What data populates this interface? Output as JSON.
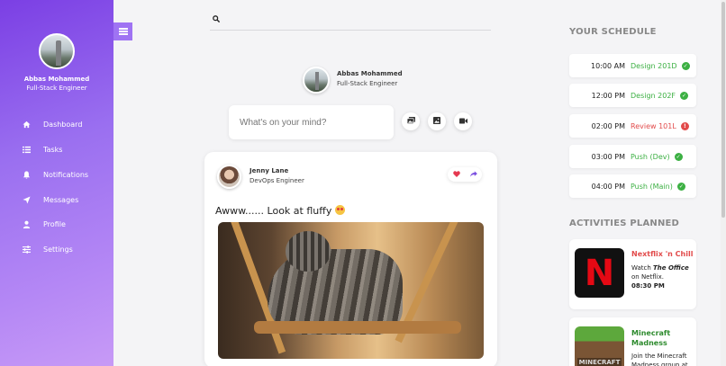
{
  "user": {
    "name": "Abbas Mohammed",
    "role": "Full-Stack Engineer"
  },
  "sidebar": {
    "items": [
      {
        "label": "Dashboard",
        "icon": "home-icon"
      },
      {
        "label": "Tasks",
        "icon": "list-icon"
      },
      {
        "label": "Notifications",
        "icon": "bell-icon"
      },
      {
        "label": "Messages",
        "icon": "send-icon"
      },
      {
        "label": "Profile",
        "icon": "user-icon"
      },
      {
        "label": "Settings",
        "icon": "sliders-icon"
      }
    ]
  },
  "search": {
    "placeholder": "",
    "value": ""
  },
  "composer": {
    "placeholder": "What's on your mind?"
  },
  "post": {
    "author": "Jenny Lane",
    "role": "DevOps Engineer",
    "text": "Awww...... Look at fluffy"
  },
  "schedule": {
    "title": "YOUR SCHEDULE",
    "items": [
      {
        "time": "10:00 AM",
        "task": "Design 201D",
        "status": "done",
        "color": "#3cb043"
      },
      {
        "time": "12:00 PM",
        "task": "Design 202F",
        "status": "done",
        "color": "#3cb043"
      },
      {
        "time": "02:00 PM",
        "task": "Review 101L",
        "status": "alert",
        "color": "#e24b4b"
      },
      {
        "time": "03:00 PM",
        "task": "Push (Dev)",
        "status": "done",
        "color": "#3cb043"
      },
      {
        "time": "04:00 PM",
        "task": "Push (Main)",
        "status": "done",
        "color": "#3cb043"
      }
    ]
  },
  "activities": {
    "title": "ACTIVITIES PLANNED",
    "items": [
      {
        "title": "Nextflix 'n Chill",
        "color": "#e24b4b",
        "desc_pre": "Watch ",
        "desc_em": "The Office",
        "desc_post": " on Netflix.",
        "time": "08:30 PM",
        "thumb": "N"
      },
      {
        "title": "Minecraft Madness",
        "color": "#2e8b2e",
        "desc": "Join the Minecraft Madness group at",
        "thumb": "MINECRAFT"
      }
    ]
  }
}
